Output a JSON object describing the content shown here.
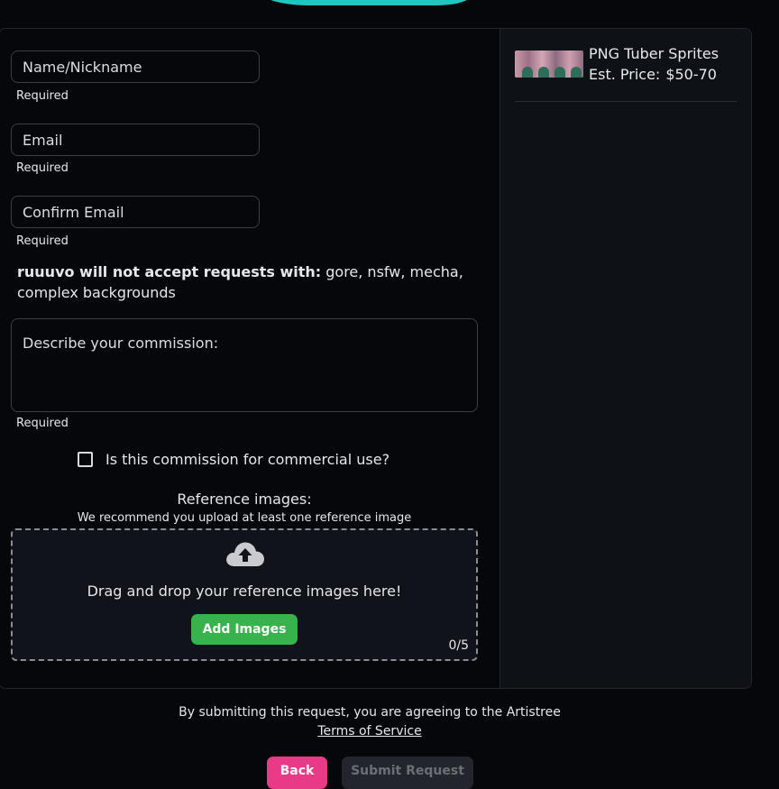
{
  "form": {
    "name_placeholder": "Name/Nickname",
    "email_placeholder": "Email",
    "confirm_email_placeholder": "Confirm Email",
    "required_label": "Required",
    "notice_bold": "ruuuvo will not accept requests with:",
    "notice_rest": " gore, nsfw, mecha, complex backgrounds",
    "description_placeholder": "Describe your commission:",
    "commercial_label": "Is this commission for commercial use?",
    "reference_title": "Reference images:",
    "reference_subtitle": "We recommend you upload at least one reference image",
    "drop_text": "Drag and drop your reference images here!",
    "add_images_label": "Add Images",
    "image_count": "0/5"
  },
  "sidebar": {
    "item_title": "PNG Tuber Sprites",
    "price_label": "Est. Price:",
    "price_value": "$50-70"
  },
  "footer": {
    "agreement_text": "By submitting this request, you are agreeing to the Artistree",
    "tos_link": "Terms of Service",
    "back_label": "Back",
    "submit_label": "Submit Request"
  },
  "colors": {
    "accent_teal": "#1ec8c0",
    "add_button": "#37b24d",
    "back_button": "#e83a86",
    "submit_disabled": "#22252b"
  }
}
